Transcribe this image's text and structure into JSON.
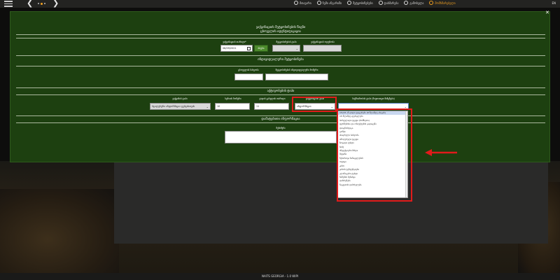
{
  "topbar": {
    "menu": [
      {
        "label": "მთავარი"
      },
      {
        "label": "ჩემი ანგარიში"
      },
      {
        "label": "შეტყობინებები"
      },
      {
        "label": "დახმარება"
      },
      {
        "label": "გამოსვლა"
      },
      {
        "label": "მომხმარებელი"
      }
    ],
    "language": "EN"
  },
  "modal": {
    "title": "ვაქცინაციის შეტყობინების წიგნი",
    "section_owner": {
      "title": "ცხოველის იდენტიფიკაცია",
      "date_label": "ვაქცინაციის თარიღი*",
      "date_value": "08/09/2021",
      "search_label": "შეტყობინების ტიპი",
      "search_btn": "ძიება",
      "code_label": "ვაქცინაციის ოდენობა"
    },
    "section_place": {
      "title": "ინდივიდუალური შეტყობინება",
      "field1_label": "ცხოველის სახეობა",
      "field2_label": "შეტყობინების ინდივიდუალური ნომერი"
    },
    "section_activity": {
      "title": "აქტივობების ტიპი",
      "col1_label": "ვაქცინის ტიპი",
      "col1_value": "სტილუსური ინფორმაცია ტესტისთვის",
      "col2_label": "სერიის ნომერი",
      "col2_value": "10",
      "col3_label": "ვადის გასვლის თარიღი",
      "col3_value": "11",
      "col4_label": "ვაქცინაციის ტიპი",
      "col4_value": "ინფორმაცია",
      "col5_label": "საქმიანობის ტიპი (მიუთითეთ მიზეზები)",
      "col5_value": ""
    },
    "section_note": {
      "title": "დამატებითი ინფორმაცია",
      "note_label": "შენიშვნა"
    }
  },
  "dropdown": {
    "options": [
      "15x15 ან დიდი ფიგურები (8 წლამდე ასაკის)",
      "15 წლამდე ფურცლები",
      "პირველადი ჯგუფი (სომხეთი)",
      "ფერმებისა და ობიექტების გადაცემა",
      "დიაგნოსტიკა",
      "გონჯი",
      "ასაცრელი სახეობა",
      "ამოღებული ჯგუფი",
      "ზოგადი ტესტი",
      "ბიძე",
      "ინფექციური ზრდა",
      "მეფინა",
      "ნებართვა ჩანაცვლების",
      "ოფიცი",
      "კიბო",
      "კიბოს ტენდენციები",
      "კლინიკური ტესტი",
      "ნიმუშის შენახვა",
      "დაბრუნება",
      "ნაკვეთის დასრულება"
    ]
  },
  "inner": {
    "button": "შენახვა"
  },
  "footer": {
    "text": "NAITS GEORGIA - 1.0 WIPI"
  }
}
